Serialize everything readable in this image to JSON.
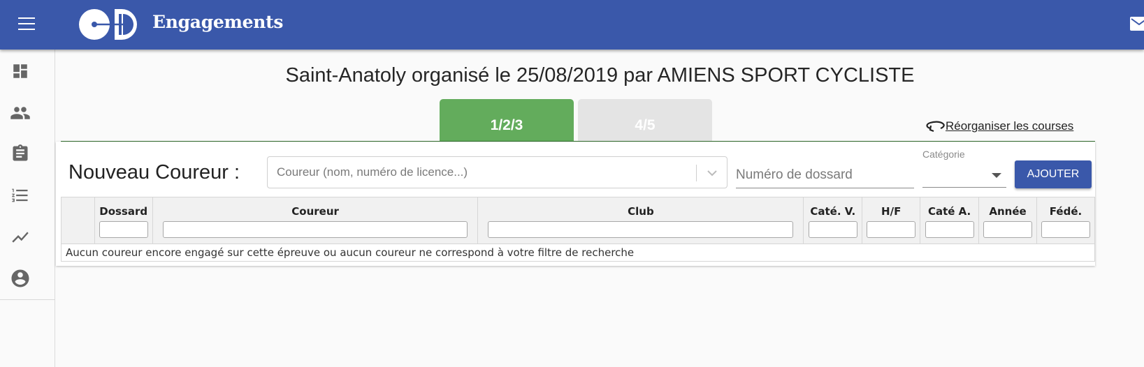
{
  "header": {
    "app_title": "Engagements",
    "brand_color": "#3a58aa"
  },
  "sidebar": {
    "items": [
      {
        "icon": "dashboard-icon"
      },
      {
        "icon": "people-icon"
      },
      {
        "icon": "clipboard-icon"
      },
      {
        "icon": "list-icon"
      },
      {
        "icon": "trending-icon"
      },
      {
        "icon": "account-icon"
      }
    ]
  },
  "main": {
    "title": "Saint-Anatoly organisé le 25/08/2019 par AMIENS SPORT CYCLISTE",
    "tabs": [
      {
        "label": "1/2/3",
        "active": true,
        "color": "#63ac5c"
      },
      {
        "label": "4/5",
        "active": false,
        "color": "#e4e4e4"
      }
    ],
    "reorganize_label": "Réorganiser les courses"
  },
  "form": {
    "new_runner_label": "Nouveau Coureur :",
    "runner_placeholder": "Coureur (nom, numéro de licence...)",
    "bib_placeholder": "Numéro de dossard",
    "category_label": "Catégorie",
    "category_value": "",
    "add_button": "AJOUTER"
  },
  "table": {
    "columns": [
      "",
      "Dossard",
      "Coureur",
      "Club",
      "Caté. V.",
      "H/F",
      "Caté A.",
      "Année",
      "Fédé."
    ],
    "empty_message": "Aucun coureur encore engagé sur cette épreuve ou aucun coureur ne correspond à votre filtre de recherche"
  }
}
